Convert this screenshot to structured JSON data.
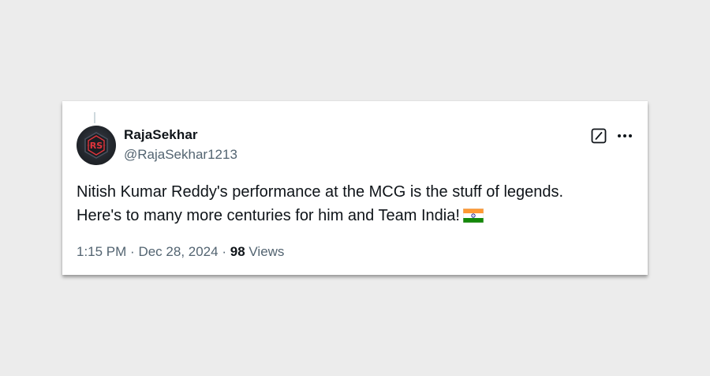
{
  "tweet": {
    "author_name": "RajaSekhar",
    "handle": "@RajaSekhar1213",
    "avatar_monogram": "RS",
    "text": "Nitish Kumar Reddy's performance at the MCG is the stuff of legends.\nHere's to many more centuries for him and Team India!",
    "emoji": "india-flag",
    "time": "1:15 PM",
    "separator": "·",
    "date": "Dec 28, 2024",
    "views_count": "98",
    "views_label": "Views"
  },
  "icons": {
    "edit": "edit-icon",
    "more": "more-icon"
  },
  "colors": {
    "page_background": "#ececec",
    "card_background": "#ffffff",
    "primary_text": "#0f1419",
    "secondary_text": "#536471",
    "avatar_accent": "#e0343c"
  }
}
